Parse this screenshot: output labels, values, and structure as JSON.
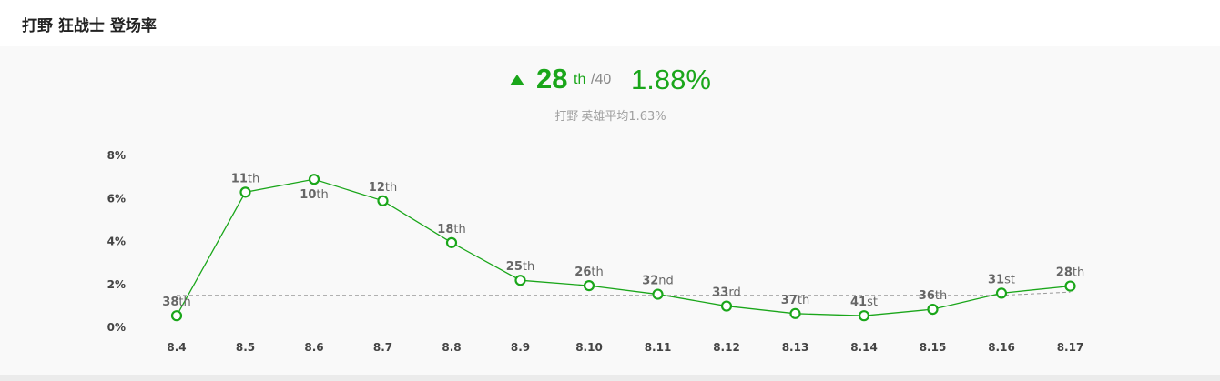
{
  "header": {
    "title": "打野 狂战士 登场率"
  },
  "summary": {
    "trend_icon": "up-triangle-icon",
    "rank": "28",
    "rank_suffix": "th",
    "rank_total": "/40",
    "rate": "1.88%",
    "avg_role": "打野",
    "avg_text": "英雄平均1.63%"
  },
  "colors": {
    "accent": "#1aa61a",
    "avg_line": "#999999",
    "text_muted": "#a0a0a0"
  },
  "chart_data": {
    "type": "line",
    "categories": [
      "8.4",
      "8.5",
      "8.6",
      "8.7",
      "8.8",
      "8.9",
      "8.10",
      "8.11",
      "8.12",
      "8.13",
      "8.14",
      "8.15",
      "8.16",
      "8.17"
    ],
    "series": [
      {
        "values": [
          0.5,
          6.25,
          6.85,
          5.85,
          3.9,
          2.15,
          1.9,
          1.5,
          0.95,
          0.6,
          0.5,
          0.8,
          1.55,
          1.88
        ],
        "ranks": [
          "38th",
          "11th",
          "10th",
          "12th",
          "18th",
          "25th",
          "26th",
          "32nd",
          "33rd",
          "37th",
          "41st",
          "36th",
          "31st",
          "28th"
        ]
      }
    ],
    "average_line": [
      1.45,
      1.45,
      1.45,
      1.45,
      1.45,
      1.45,
      1.45,
      1.45,
      1.45,
      1.45,
      1.45,
      1.45,
      1.45,
      1.6
    ],
    "yticks": [
      "0%",
      "2%",
      "4%",
      "6%",
      "8%"
    ],
    "ylim": [
      0,
      8
    ],
    "grid": false
  }
}
